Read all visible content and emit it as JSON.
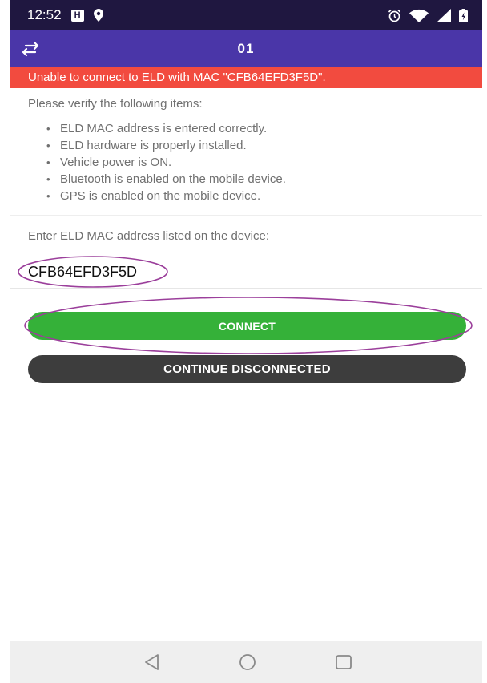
{
  "status_bar": {
    "time": "12:52",
    "badge": "H"
  },
  "app_bar": {
    "title": "01"
  },
  "error_banner": {
    "text": "Unable to connect to ELD with MAC \"CFB64EFD3F5D\"."
  },
  "verify": {
    "intro": "Please verify the following items:",
    "items": [
      "ELD MAC address is entered correctly.",
      "ELD hardware is properly installed.",
      "Vehicle power is ON.",
      "Bluetooth is enabled on the mobile device.",
      "GPS is enabled on the mobile device."
    ]
  },
  "mac_entry": {
    "label": "Enter ELD MAC address listed on the device:",
    "value": "CFB64EFD3F5D"
  },
  "buttons": {
    "connect": "CONNECT",
    "continue_disconnected": "CONTINUE DISCONNECTED"
  },
  "colors": {
    "status_bar": "#1f1740",
    "app_bar": "#4a36a8",
    "error": "#f24b3f",
    "connect": "#35b139",
    "continue": "#3d3d3d",
    "annotation": "#9b3f9b"
  },
  "icons": {
    "app_bar": "swap-arrows-icon",
    "status": [
      "location-pin-icon",
      "alarm-icon",
      "wifi-icon",
      "signal-icon",
      "battery-icon"
    ],
    "nav": [
      "back-icon",
      "home-icon",
      "recents-icon"
    ]
  }
}
